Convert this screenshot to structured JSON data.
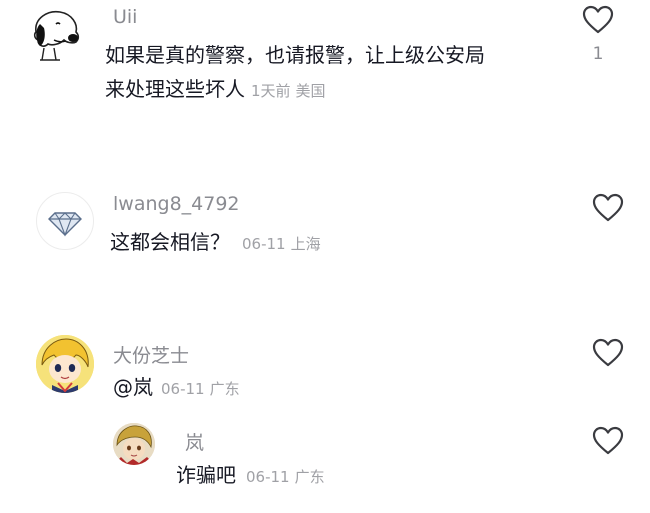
{
  "comments": [
    {
      "username": "Uii",
      "text_line1": "如果是真的警察，也请报警，让上级公安局",
      "text_line2": "来处理这些坏人",
      "time": "1天前",
      "location": "美国",
      "likes": "1",
      "avatar_icon": "snoopy-avatar"
    },
    {
      "username": "lwang8_4792",
      "text": "这都会相信？",
      "time": "06-11",
      "location": "上海",
      "avatar_icon": "diamond-avatar"
    },
    {
      "username": "大份芝士",
      "mention": "@岚",
      "time": "06-11",
      "location": "广东",
      "avatar_icon": "anime-girl-avatar"
    },
    {
      "username": "岚",
      "text": "诈骗吧",
      "time": "06-11",
      "location": "广东",
      "avatar_icon": "anime-boy-avatar",
      "is_reply": true
    }
  ]
}
